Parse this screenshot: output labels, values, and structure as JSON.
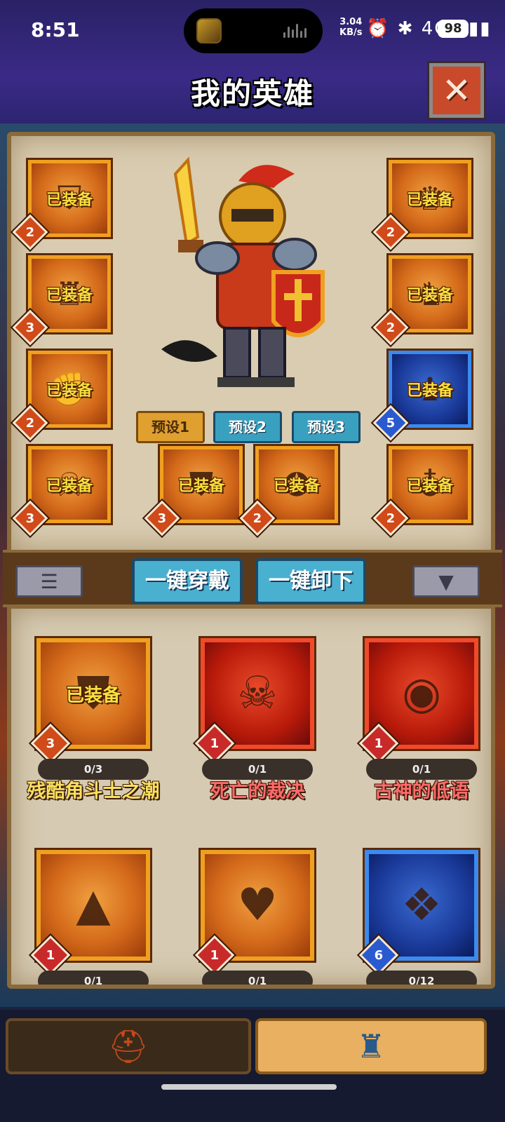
{
  "status_bar": {
    "time": "8:51",
    "net_speed": "3.04",
    "net_unit": "KB/s",
    "icons": "⏰ ✱ 4G ▮▮▮",
    "battery": "98"
  },
  "header": {
    "title": "我的英雄",
    "close_glyph": "✕"
  },
  "equipped_label": "已装备",
  "slots": {
    "left_1": {
      "level": "2",
      "icon": "horned-helmet"
    },
    "left_2": {
      "level": "3",
      "icon": "dark-armor"
    },
    "left_3": {
      "level": "2",
      "icon": "gauntlet"
    },
    "left_4": {
      "level": "3",
      "icon": "skull-weapon"
    },
    "right_1": {
      "level": "2",
      "icon": "flame-helm"
    },
    "right_2": {
      "level": "2",
      "icon": "boots"
    },
    "right_3": {
      "level": "5",
      "icon": "blue-beast-armor"
    },
    "right_4": {
      "level": "2",
      "icon": "amulet"
    },
    "center_1": {
      "level": "3",
      "icon": "green-shield"
    },
    "center_2": {
      "level": "2",
      "icon": "star-ring"
    }
  },
  "presets": [
    "预设1",
    "预设2",
    "预设3"
  ],
  "toolbar": {
    "equip_all": "一键穿戴",
    "unequip_all": "一键卸下",
    "list_icon": "list-icon",
    "filter_icon": "filter-icon"
  },
  "cards": [
    {
      "name": "残酷角斗士之潮",
      "progress": "0/3",
      "level": "3",
      "equipped": true,
      "rarity": "orange",
      "icon": "green-shield"
    },
    {
      "name": "死亡的裁决",
      "progress": "0/1",
      "level": "1",
      "equipped": false,
      "rarity": "red",
      "icon": "skull-pendant"
    },
    {
      "name": "古神的低语",
      "progress": "0/1",
      "level": "1",
      "equipped": false,
      "rarity": "red",
      "icon": "eye-pendant"
    },
    {
      "name": "",
      "progress": "0/1",
      "level": "1",
      "equipped": false,
      "rarity": "orange",
      "icon": "volcano-card"
    },
    {
      "name": "",
      "progress": "0/1",
      "level": "1",
      "equipped": false,
      "rarity": "orange",
      "icon": "heart-chain-pendant"
    },
    {
      "name": "",
      "progress": "0/12",
      "level": "6",
      "equipped": false,
      "rarity": "blue",
      "icon": "magic-tome"
    }
  ],
  "bottom_nav": {
    "hero_tab_icon": "viking-helmet-icon",
    "gear_tab_icon": "armor-icon"
  }
}
